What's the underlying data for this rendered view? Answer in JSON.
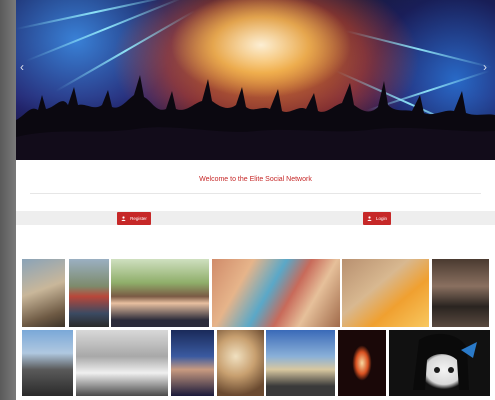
{
  "hero": {
    "prev_arrow": "‹",
    "next_arrow": "›"
  },
  "welcome": {
    "text": "Welcome to the Elite Social Network"
  },
  "actions": {
    "register_label": "Register",
    "login_label": "Login"
  },
  "colors": {
    "accent": "#c62828"
  },
  "gallery": {
    "photos": [
      "photo-man-on-couch",
      "photo-man-outdoors",
      "photo-group-of-friends",
      "photo-graffiti-wall",
      "photo-lying-on-pillow",
      "photo-man-in-living-room",
      "photo-man-on-mountain",
      "photo-man-in-plane",
      "photo-selfie-couple",
      "photo-food-dishes",
      "photo-man-at-sunset",
      "photo-airplane-window",
      "photo-anime-girl"
    ]
  }
}
